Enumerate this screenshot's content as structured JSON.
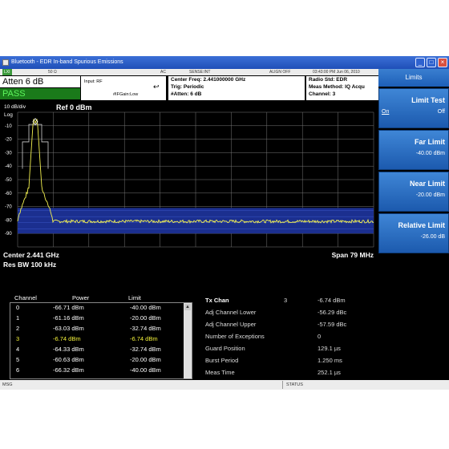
{
  "window": {
    "title": "Bluetooth - EDR In-band Spurious Emissions"
  },
  "status_strip": {
    "lxi": "LXI",
    "impedance": "50 Ω",
    "coupling": "AC",
    "sense": "SENSE:INT",
    "align": "ALIGN OFF",
    "datetime": "03:43:00 PM Jun 06, 2010"
  },
  "header": {
    "atten": "Atten  6 dB",
    "pass": "PASS",
    "input": "Input: RF",
    "gain": "#IFGain:Low",
    "center_freq": "Center Freq: 2.441000000 GHz",
    "trig": "Trig: Periodic",
    "atten_small": "#Atten: 6 dB",
    "radio_std": "Radio Std: EDR",
    "meas_method": "Meas Method: IQ Acqu",
    "channel": "Channel: 3"
  },
  "plot": {
    "scale": "10 dB/div",
    "ref": "Ref  0 dBm",
    "log": "Log",
    "y_ticks": [
      "-10",
      "-20",
      "-30",
      "-40",
      "-50",
      "-60",
      "-70",
      "-80",
      "-90"
    ],
    "center": "Center  2.441 GHz",
    "res_bw": "Res BW  100 kHz",
    "span": "Span 79 MHz"
  },
  "table": {
    "headers": {
      "channel": "Channel",
      "power": "Power",
      "limit": "Limit"
    },
    "rows": [
      {
        "channel": "0",
        "power": "-66.71 dBm",
        "limit": "-40.00 dBm",
        "selected": false
      },
      {
        "channel": "1",
        "power": "-61.16 dBm",
        "limit": "-20.00 dBm",
        "selected": false
      },
      {
        "channel": "2",
        "power": "-63.03 dBm",
        "limit": "-32.74 dBm",
        "selected": false
      },
      {
        "channel": "3",
        "power": "-6.74 dBm",
        "limit": "-6.74 dBm",
        "selected": true
      },
      {
        "channel": "4",
        "power": "-64.33 dBm",
        "limit": "-32.74 dBm",
        "selected": false
      },
      {
        "channel": "5",
        "power": "-60.63 dBm",
        "limit": "-20.00 dBm",
        "selected": false
      },
      {
        "channel": "6",
        "power": "-66.32 dBm",
        "limit": "-40.00 dBm",
        "selected": false
      }
    ],
    "results": [
      {
        "label": "Tx Chan",
        "extra": "3",
        "value": "-6.74 dBm"
      },
      {
        "label": "Adj Channel Lower",
        "extra": "",
        "value": "-56.29 dBc"
      },
      {
        "label": "Adj Channel Upper",
        "extra": "",
        "value": "-57.59 dBc"
      },
      {
        "label": "Number of Exceptions",
        "extra": "",
        "value": "0"
      },
      {
        "label": "Guard Position",
        "extra": "",
        "value": "129.1 µs"
      },
      {
        "label": "Burst Period",
        "extra": "",
        "value": "1.250 ms"
      },
      {
        "label": "Meas Time",
        "extra": "",
        "value": "252.1 µs"
      }
    ]
  },
  "msgbar": {
    "msg": "MSG",
    "status": "STATUS"
  },
  "softkeys": {
    "title": "Limits",
    "limit_test": {
      "label": "Limit Test",
      "on": "On",
      "off": "Off"
    },
    "far_limit": {
      "label": "Far Limit",
      "value": "-40.00 dBm"
    },
    "near_limit": {
      "label": "Near Limit",
      "value": "-20.00 dBm"
    },
    "relative_limit": {
      "label": "Relative Limit",
      "value": "-26.00 dB"
    }
  },
  "colors": {
    "trace": "#f4f250",
    "limit_band": "#1b2f8f",
    "pass_text": "#5df55d",
    "selected_row": "#f5f33a",
    "softkey": "#2a6dc4"
  }
}
